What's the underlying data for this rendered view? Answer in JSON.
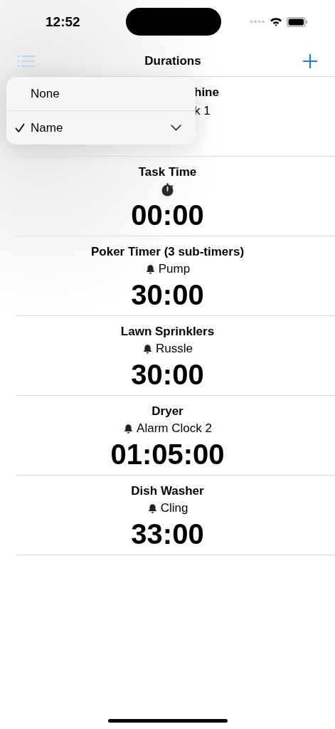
{
  "status_bar": {
    "time": "12:52"
  },
  "nav": {
    "title": "Durations"
  },
  "menu": {
    "items": [
      {
        "label": "None",
        "selected": false,
        "submenu": false
      },
      {
        "label": "Name",
        "selected": true,
        "submenu": true
      }
    ]
  },
  "rows": [
    {
      "kind": "covered",
      "title": "hine",
      "sound": "k 1"
    },
    {
      "kind": "stopwatch",
      "title": "Task Time",
      "time": "00:00"
    },
    {
      "kind": "alarm",
      "title": "Poker Timer (3 sub-timers)",
      "sound": "Pump",
      "time": "30:00"
    },
    {
      "kind": "alarm",
      "title": "Lawn Sprinklers",
      "sound": "Russle",
      "time": "30:00"
    },
    {
      "kind": "alarm",
      "title": "Dryer",
      "sound": "Alarm Clock 2",
      "time": "01:05:00"
    },
    {
      "kind": "alarm",
      "title": "Dish Washer",
      "sound": "Cling",
      "time": "33:00"
    }
  ]
}
